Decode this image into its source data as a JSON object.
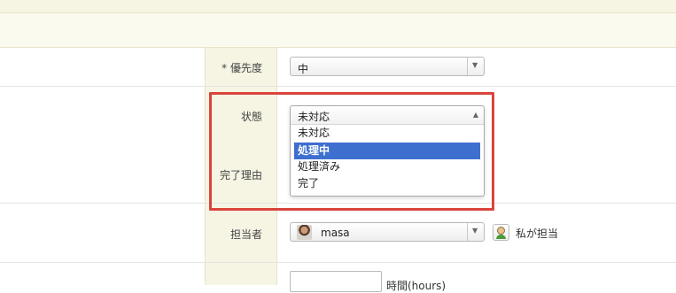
{
  "form": {
    "priority": {
      "label": "* 優先度",
      "value": "中"
    },
    "status": {
      "label": "状態",
      "selected": "未対応",
      "options": [
        "未対応",
        "処理中",
        "処理済み",
        "完了"
      ],
      "highlighted_index": 1
    },
    "resolution": {
      "label": "完了理由"
    },
    "assignee": {
      "label": "担当者",
      "value": "masa",
      "assign_me_label": "私が担当"
    },
    "hours": {
      "value": "",
      "unit_label": "時間(hours)"
    }
  },
  "icons": {
    "dropdown_arrow": "chevron-down-icon",
    "dropdown_open_arrow": "chevron-up-icon",
    "assignee_avatar": "user-avatar",
    "assign_me": "person-icon"
  },
  "colors": {
    "highlight": "#d9443b",
    "selected_option": "#3d6fcf",
    "label_column": "#f6f5e4"
  }
}
